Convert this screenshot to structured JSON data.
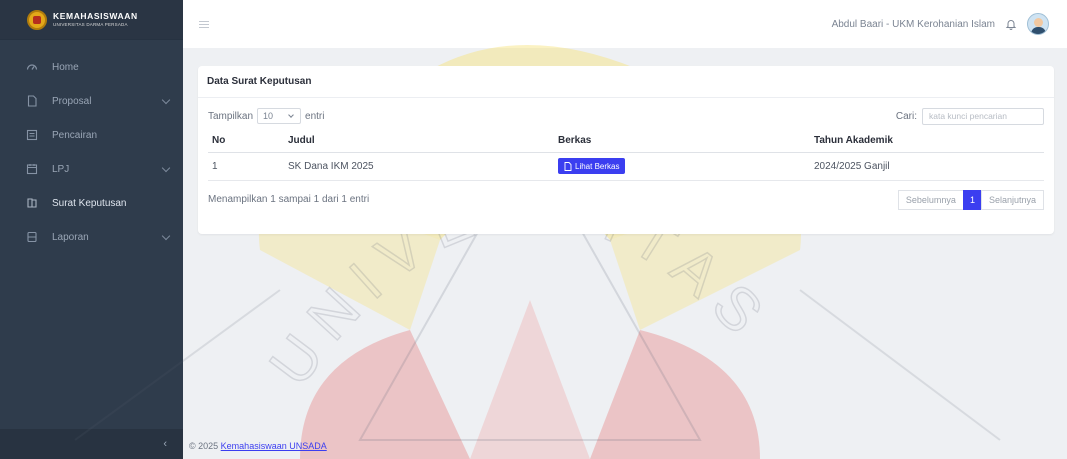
{
  "brand": {
    "title": "KEMAHASISWAAN",
    "subtitle": "UNIVERSITAS DARMA PERSADA"
  },
  "sidebar": {
    "items": [
      {
        "label": "Home",
        "icon": "dashboard-icon",
        "has_submenu": false
      },
      {
        "label": "Proposal",
        "icon": "file-icon",
        "has_submenu": true
      },
      {
        "label": "Pencairan",
        "icon": "receipt-icon",
        "has_submenu": false
      },
      {
        "label": "LPJ",
        "icon": "calendar-icon",
        "has_submenu": true
      },
      {
        "label": "Surat Keputusan",
        "icon": "document-icon",
        "has_submenu": false,
        "active": true
      },
      {
        "label": "Laporan",
        "icon": "report-icon",
        "has_submenu": true
      }
    ],
    "collapse_symbol": "‹"
  },
  "topbar": {
    "user": "Abdul Baari - UKM Kerohanian Islam",
    "notification_icon": "bell-icon",
    "avatar_icon": "user-avatar"
  },
  "card": {
    "title": "Data Surat Keputusan",
    "length_prefix": "Tampilkan",
    "length_value": "10",
    "length_suffix": "entri",
    "search_label": "Cari:",
    "search_placeholder": "kata kunci pencarian",
    "search_value": "",
    "columns": [
      "No",
      "Judul",
      "Berkas",
      "Tahun Akademik"
    ],
    "rows": [
      {
        "no": "1",
        "judul": "SK Dana IKM 2025",
        "berkas_label": "Lihat Berkas",
        "tahun": "2024/2025 Ganjil"
      }
    ],
    "info": "Menampilkan 1 sampai 1 dari 1 entri",
    "pagination": {
      "prev": "Sebelumnya",
      "current": "1",
      "next": "Selanjutnya"
    }
  },
  "footer": {
    "prefix": "© 2025",
    "link_text": "Kemahasiswaan UNSADA"
  },
  "watermark": {
    "text": "UNIVERSITAS"
  },
  "colors": {
    "sidebar_bg": "#2f3c4c",
    "accent": "#3b3ef0",
    "page_bg": "#eef0f3",
    "watermark_gold": "#f2c200",
    "watermark_red": "#c62828"
  }
}
